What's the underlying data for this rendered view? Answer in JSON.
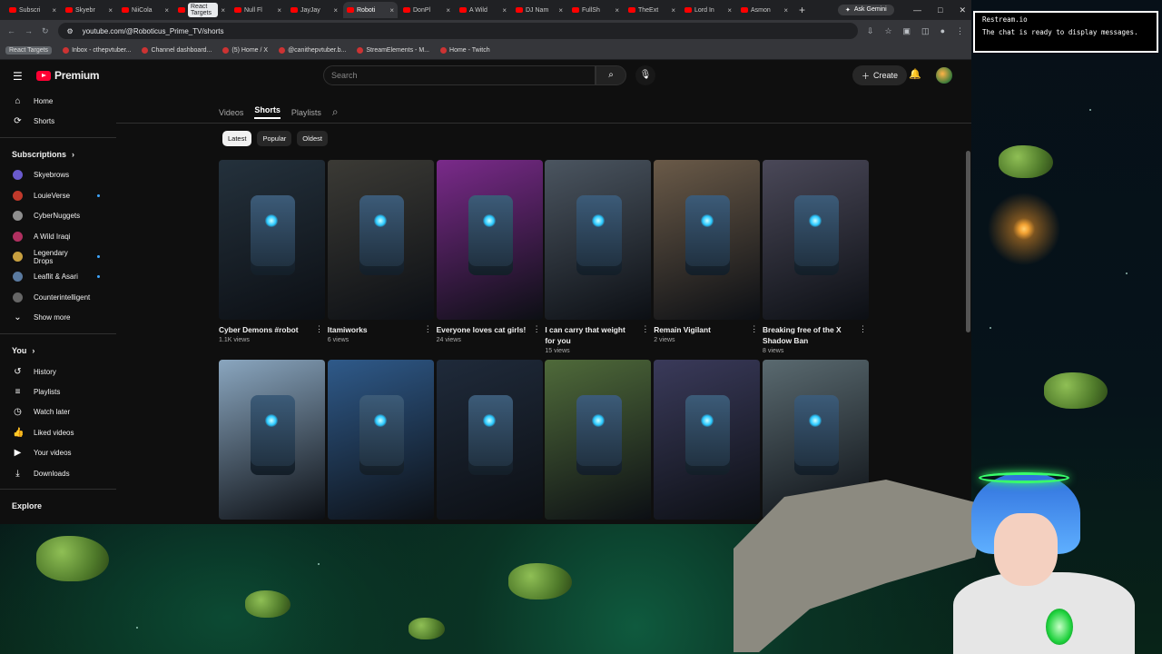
{
  "browser": {
    "tabs": [
      {
        "label": "Subscri"
      },
      {
        "label": "Skyebr"
      },
      {
        "label": "NiiCola"
      },
      {
        "label": "React Targets",
        "pill": true
      },
      {
        "label": "Null Fl"
      },
      {
        "label": "JayJay"
      },
      {
        "label": "Roboti",
        "active": true
      },
      {
        "label": "DonPl"
      },
      {
        "label": "A Wild"
      },
      {
        "label": "DJ Nam"
      },
      {
        "label": "FullSh"
      },
      {
        "label": "TheExt"
      },
      {
        "label": "Lord In"
      },
      {
        "label": "Asmon"
      }
    ],
    "new_tab": "+",
    "gemini_label": "Ask Gemini",
    "url": "youtube.com/@Roboticus_Prime_TV/shorts",
    "bookmarks": [
      {
        "label": "React Targets",
        "pill": true
      },
      {
        "label": "Inbox - cthepvtuber..."
      },
      {
        "label": "Channel dashboard..."
      },
      {
        "label": "(5) Home / X"
      },
      {
        "label": "@canithepvtuber.b..."
      },
      {
        "label": "StreamElements - M..."
      },
      {
        "label": "Home - Twitch"
      }
    ]
  },
  "youtube": {
    "brand": "Premium",
    "search_placeholder": "Search",
    "create_label": "Create",
    "sidebar": {
      "top": [
        {
          "label": "Home",
          "icon": "home-icon"
        },
        {
          "label": "Shorts",
          "icon": "shorts-icon"
        }
      ],
      "subscriptions_title": "Subscriptions",
      "subscriptions": [
        {
          "label": "Skyebrows",
          "color": "#6a5acd"
        },
        {
          "label": "LouieVerse",
          "color": "#c0392b"
        },
        {
          "label": "CyberNuggets",
          "color": "#8e8e8e"
        },
        {
          "label": "A Wild Iraqi",
          "color": "#b03060"
        },
        {
          "label": "Legendary Drops",
          "color": "#c8a040"
        },
        {
          "label": "Leaflit & Asari",
          "color": "#5a7aa0"
        },
        {
          "label": "Counterintelligent",
          "color": "#666666"
        }
      ],
      "show_more": "Show more",
      "you_title": "You",
      "you": [
        {
          "label": "History",
          "icon": "history-icon"
        },
        {
          "label": "Playlists",
          "icon": "playlists-icon"
        },
        {
          "label": "Watch later",
          "icon": "clock-icon"
        },
        {
          "label": "Liked videos",
          "icon": "thumbs-up-icon"
        },
        {
          "label": "Your videos",
          "icon": "video-icon"
        },
        {
          "label": "Downloads",
          "icon": "download-icon"
        }
      ],
      "explore_title": "Explore"
    },
    "channel_tabs": [
      "Videos",
      "Shorts",
      "Playlists"
    ],
    "active_tab": "Shorts",
    "chips": [
      "Latest",
      "Popular",
      "Oldest"
    ],
    "active_chip": "Latest",
    "shorts": [
      {
        "title": "Cyber Demons #robot",
        "views": "1.1K views",
        "bg": "#24313c"
      },
      {
        "title": "Itamiworks",
        "views": "6 views",
        "bg": "#3b3a35"
      },
      {
        "title": "Everyone loves cat girls!",
        "views": "24 views",
        "bg": "#7a2a8a"
      },
      {
        "title": "I can carry that weight for you",
        "views": "15 views",
        "bg": "#4b5560"
      },
      {
        "title": "Remain Vigilant",
        "views": "2 views",
        "bg": "#6a5a48"
      },
      {
        "title": "Breaking free of the X Shadow Ban",
        "views": "8 views",
        "bg": "#4a4858"
      },
      {
        "title": "",
        "views": "",
        "bg": "#8aa6bf"
      },
      {
        "title": "",
        "views": "",
        "bg": "#2f5a8a"
      },
      {
        "title": "",
        "views": "",
        "bg": "#1f2a3a"
      },
      {
        "title": "",
        "views": "",
        "bg": "#4f6a3a"
      },
      {
        "title": "",
        "views": "",
        "bg": "#3a3a5a"
      },
      {
        "title": "",
        "views": "",
        "bg": "#5a6a70"
      }
    ]
  },
  "restream": {
    "title": "Restream.io",
    "message": "The chat is ready to display messages."
  }
}
